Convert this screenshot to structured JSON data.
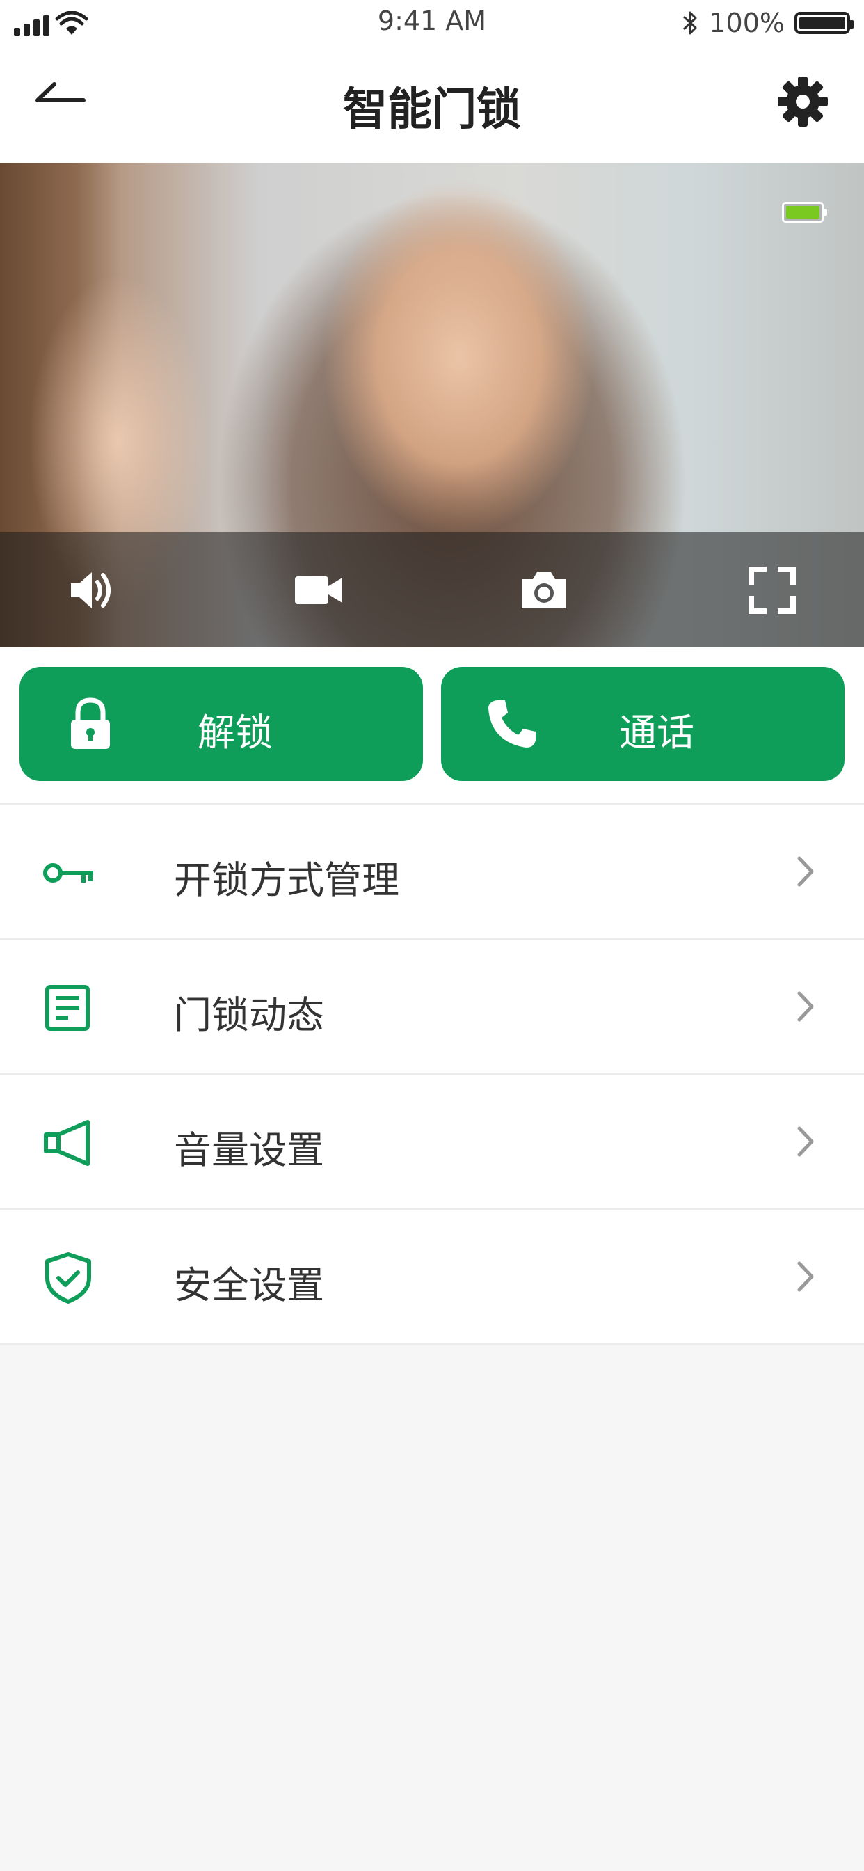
{
  "status_bar": {
    "time": "9:41 AM",
    "battery_percent": "100%"
  },
  "header": {
    "title": "智能门锁"
  },
  "video": {
    "camera_battery_level": 1.0,
    "controls": [
      "speaker-icon",
      "video-camera-icon",
      "camera-icon",
      "fullscreen-icon"
    ]
  },
  "actions": {
    "unlock_label": "解锁",
    "call_label": "通话"
  },
  "menu": {
    "items": [
      {
        "label": "开锁方式管理",
        "icon": "key-icon"
      },
      {
        "label": "门锁动态",
        "icon": "document-icon"
      },
      {
        "label": "音量设置",
        "icon": "speaker-outline-icon"
      },
      {
        "label": "安全设置",
        "icon": "shield-check-icon"
      }
    ]
  },
  "colors": {
    "accent": "#0e9e59",
    "camera_battery": "#7ac921"
  }
}
